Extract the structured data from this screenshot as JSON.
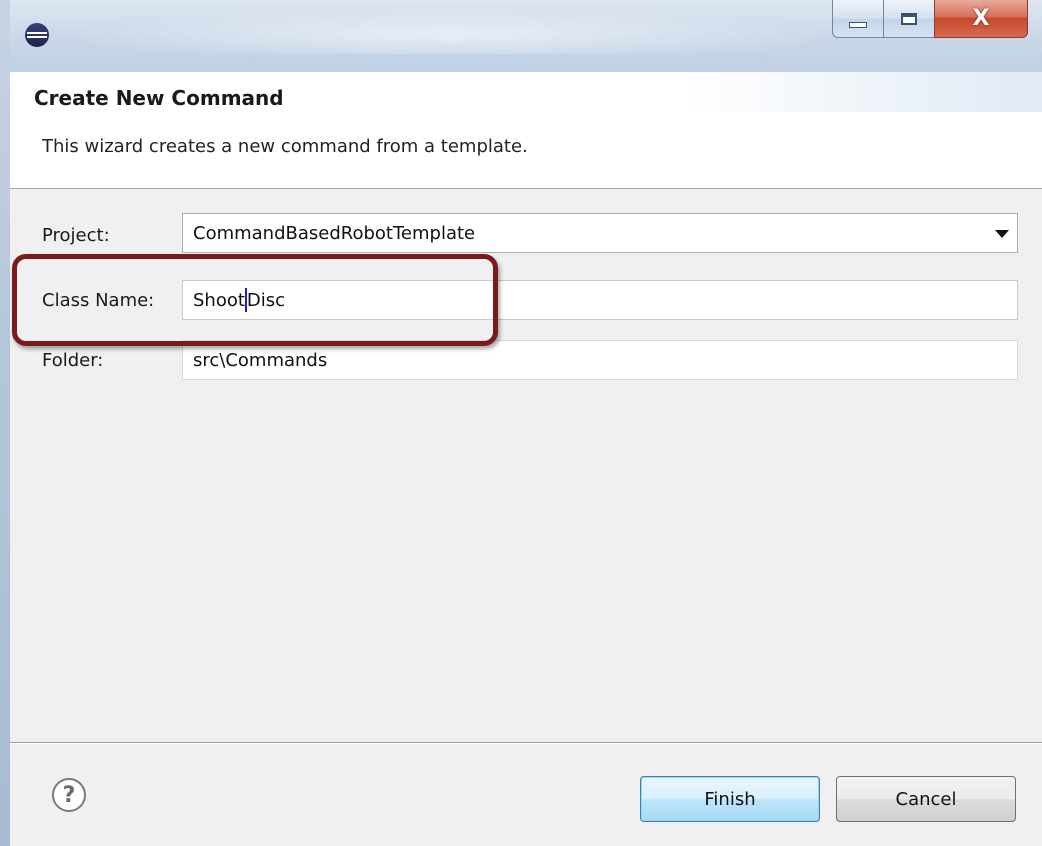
{
  "window": {
    "app_icon": "eclipse-icon",
    "controls": {
      "close_glyph": "X"
    }
  },
  "header": {
    "title": "Create New Command",
    "description": "This wizard creates a new command from a template."
  },
  "form": {
    "project_label": "Project:",
    "project_value": "CommandBasedRobotTemplate",
    "class_name_label": "Class Name:",
    "class_name_before_caret": "Shoot",
    "class_name_after_caret": "Disc",
    "folder_label": "Folder:",
    "folder_value": "src\\Commands"
  },
  "footer": {
    "help_icon_glyph": "?",
    "finish_label": "Finish",
    "cancel_label": "Cancel"
  },
  "colors": {
    "highlight_border": "#7a1b1b",
    "finish_button_accent": "#3c7fb1",
    "titlebar": "#c9d7e8"
  }
}
